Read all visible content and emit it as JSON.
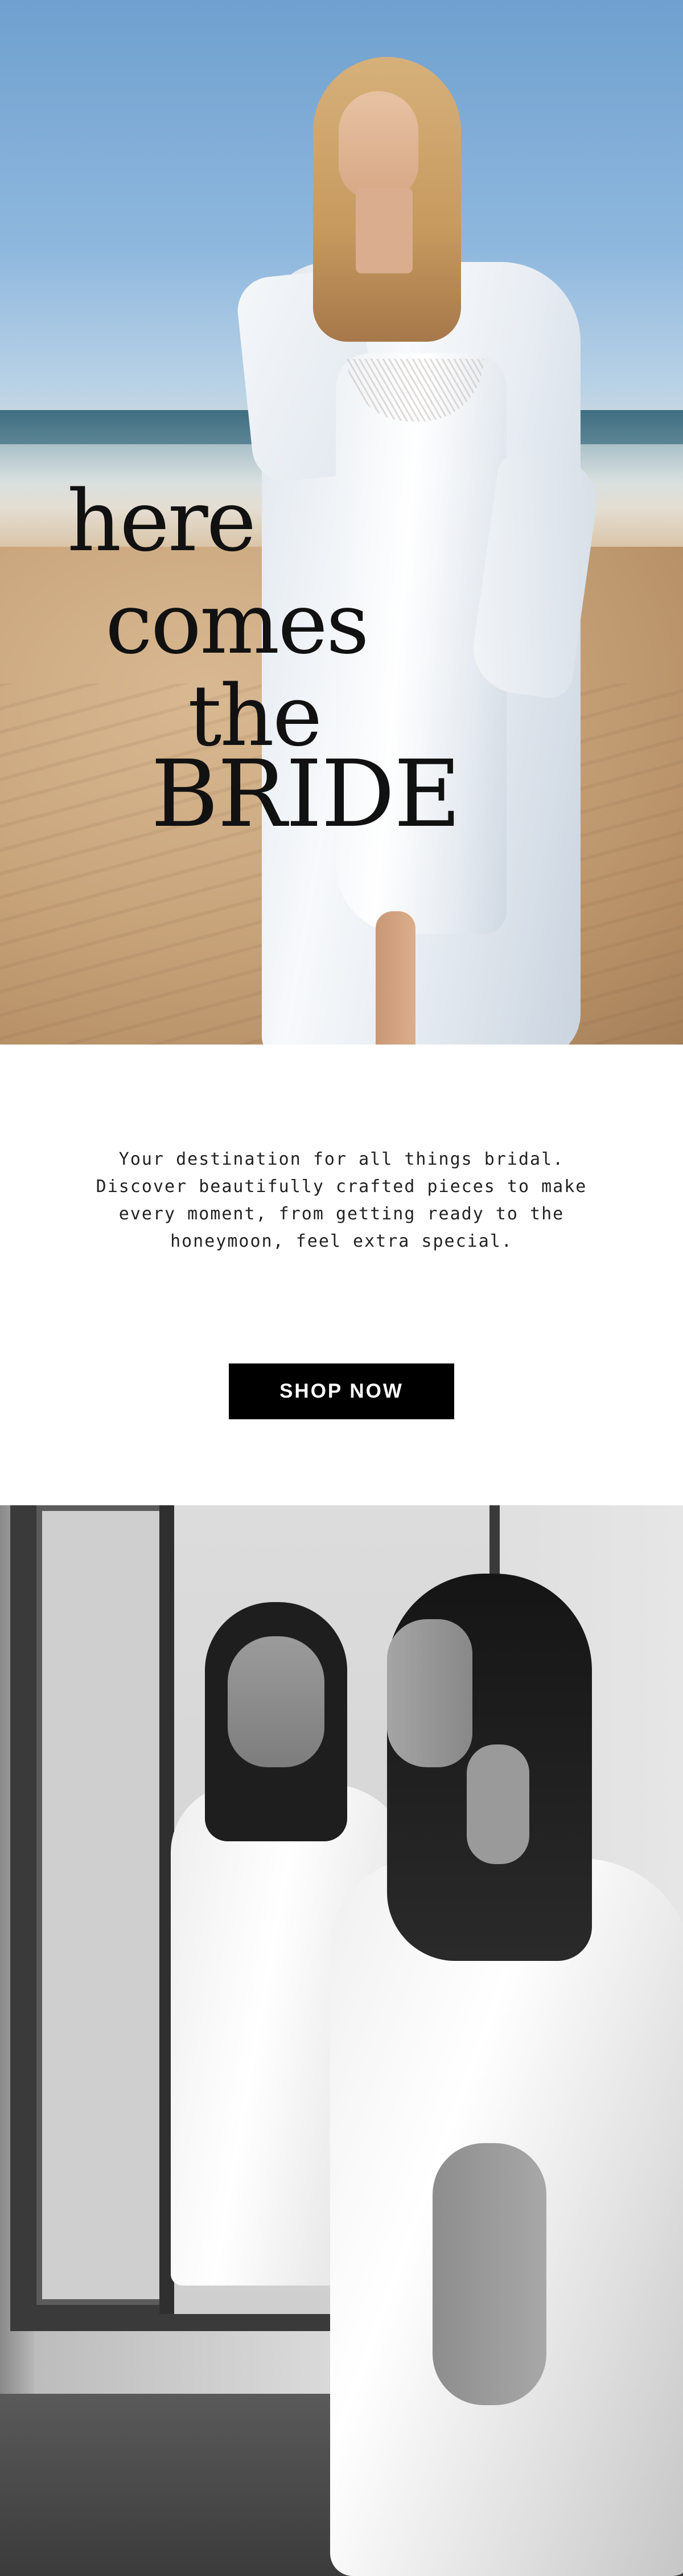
{
  "hero": {
    "image_alt": "Bride in white satin slip and robe walking on a beach",
    "headline": {
      "line1": "here",
      "line2": "comes",
      "line3": "the",
      "line4": "BRIDE"
    }
  },
  "intro": {
    "text": "Your destination for all things bridal. Discover beautifully crafted pieces to make every moment, from getting ready to the honeymoon, feel extra special."
  },
  "cta": {
    "label": "SHOP NOW"
  },
  "lifestyle": {
    "image_alt": "Black and white photo of a woman in a satin robe looking into a mirror"
  },
  "colors": {
    "background": "#ffffff",
    "text": "#222222",
    "button_bg": "#000000",
    "button_text": "#ffffff"
  }
}
